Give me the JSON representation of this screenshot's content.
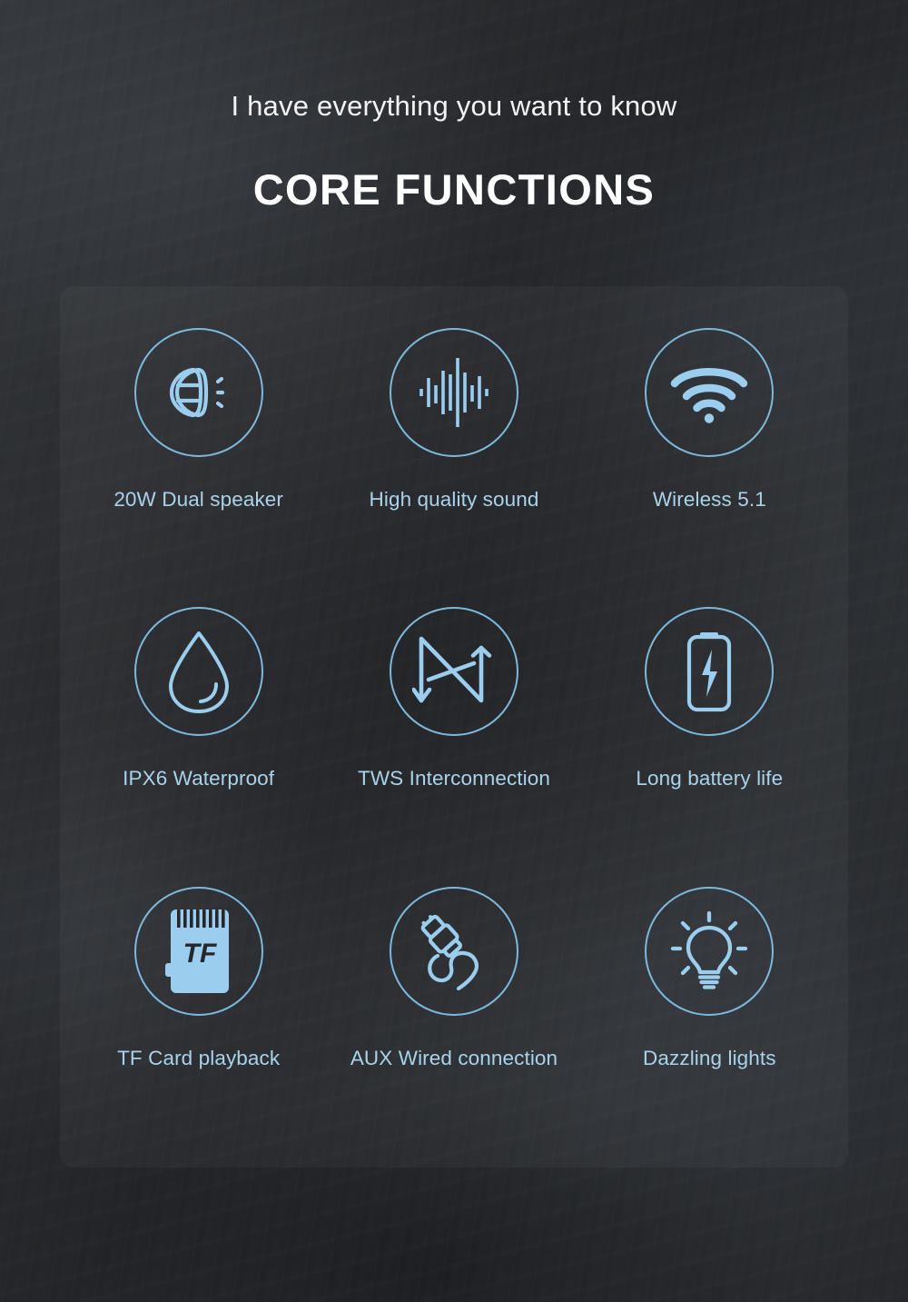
{
  "header": {
    "subtitle": "I have everything you want to know",
    "title": "CORE FUNCTIONS"
  },
  "colors": {
    "background": "#2c2e31",
    "panel": "rgba(255,255,255,0.035)",
    "icon_stroke": "#7cb9dd",
    "icon_fill_light": "#9bcdee",
    "label_text": "#a9d3ea",
    "title_text": "#ffffff",
    "subtitle_text": "#f2f3f4"
  },
  "features": [
    {
      "icon": "dual-speaker-icon",
      "label": "20W Dual speaker"
    },
    {
      "icon": "audio-waveform-icon",
      "label": "High quality sound"
    },
    {
      "icon": "wifi-icon",
      "label": "Wireless 5.1"
    },
    {
      "icon": "water-drop-icon",
      "label": "IPX6 Waterproof"
    },
    {
      "icon": "sync-interconnect-icon",
      "label": "TWS Interconnection"
    },
    {
      "icon": "battery-charging-icon",
      "label": "Long battery life"
    },
    {
      "icon": "tf-card-icon",
      "label": "TF Card playback"
    },
    {
      "icon": "audio-jack-cable-icon",
      "label": "AUX Wired connection"
    },
    {
      "icon": "lightbulb-icon",
      "label": "Dazzling lights"
    }
  ],
  "tf_card": {
    "text": "TF"
  }
}
